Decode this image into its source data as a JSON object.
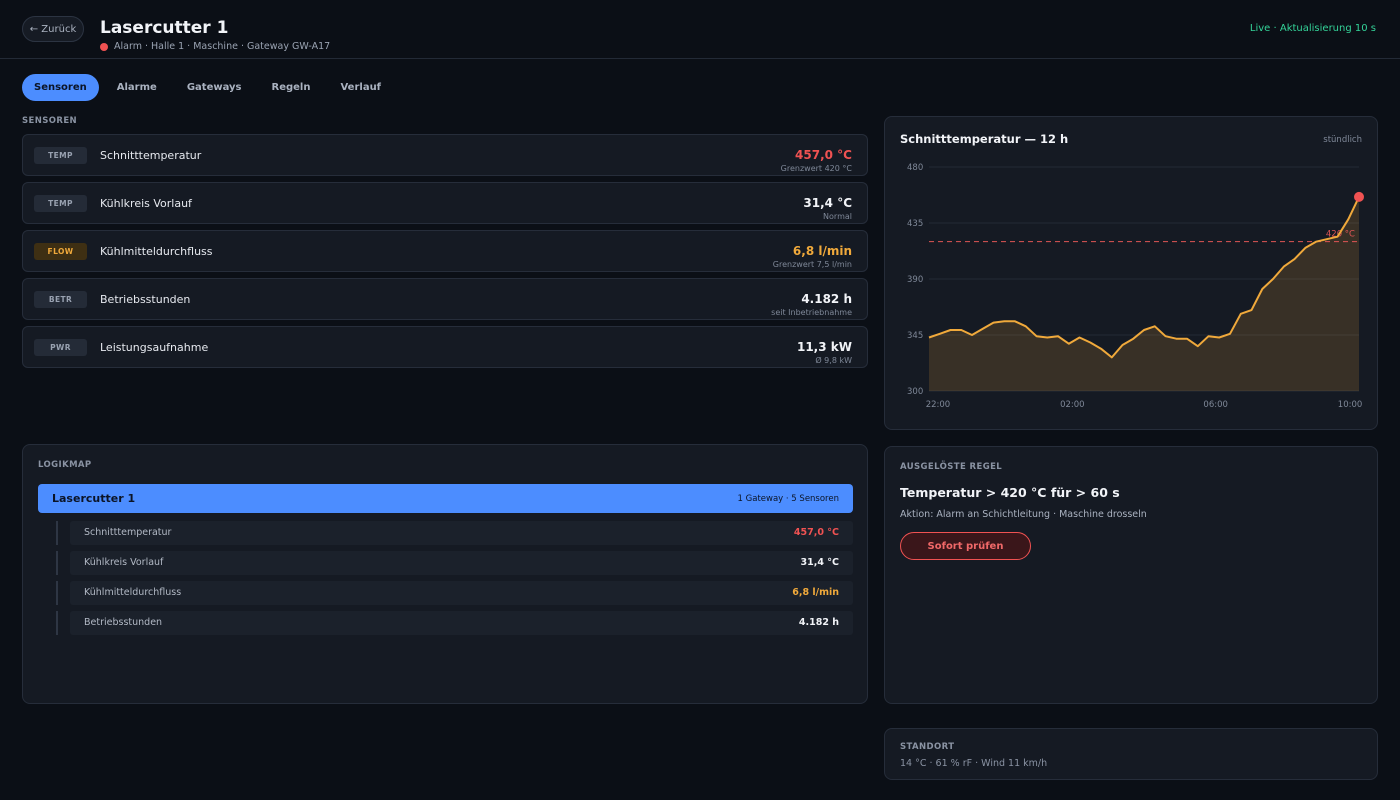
{
  "header": {
    "back_label": "← Zurück",
    "title": "Lasercutter 1",
    "subline": "Alarm · Halle 1 · Maschine · Gateway GW-A17",
    "live": "Live · Aktualisierung 10 s"
  },
  "tabs": [
    {
      "label": "Sensoren",
      "active": true
    },
    {
      "label": "Alarme"
    },
    {
      "label": "Gateways"
    },
    {
      "label": "Regeln"
    },
    {
      "label": "Verlauf"
    }
  ],
  "sensors": {
    "section_label": "SENSOREN",
    "items": [
      {
        "tag": "TEMP",
        "name": "Schnitttemperatur",
        "value": "457,0 °C",
        "note": "Grenzwert 420 °C",
        "state": "alarm"
      },
      {
        "tag": "TEMP",
        "name": "Kühlkreis Vorlauf",
        "value": "31,4 °C",
        "note": "Normal",
        "state": "ok"
      },
      {
        "tag": "FLOW",
        "name": "Kühlmitteldurchfluss",
        "value": "6,8 l/min",
        "note": "Grenzwert 7,5 l/min",
        "state": "warn"
      },
      {
        "tag": "BETR",
        "name": "Betriebsstunden",
        "value": "4.182 h",
        "note": "seit Inbetriebnahme",
        "state": "ok"
      },
      {
        "tag": "PWR",
        "name": "Leistungsaufnahme",
        "value": "11,3 kW",
        "note": "Ø 9,8 kW",
        "state": "ok"
      }
    ]
  },
  "chart": {
    "title": "Schnitttemperatur — 12 h",
    "subtitle": "stündlich",
    "threshold_label": "420 °C",
    "colors": {
      "line": "#f0a93b",
      "threshold": "#e05555",
      "point": "#f05252"
    }
  },
  "chart_data": {
    "type": "area",
    "title": "Schnitttemperatur — 12 h",
    "xlabel": "",
    "ylabel": "",
    "ylim": [
      300,
      480
    ],
    "yticks": [
      300,
      345,
      390,
      435,
      480
    ],
    "xticks": [
      {
        "label": "22:00",
        "x": 0.25
      },
      {
        "label": "02:00",
        "x": 4
      },
      {
        "label": "06:00",
        "x": 8
      },
      {
        "label": "10:00",
        "x": 11.75
      }
    ],
    "x_range": [
      0,
      12
    ],
    "threshold": 420,
    "grid": true,
    "series": [
      {
        "values": [
          343,
          346,
          349,
          349,
          345,
          350,
          355,
          356,
          356,
          352,
          344,
          343,
          344,
          338,
          343,
          339,
          334,
          327,
          337,
          342,
          349,
          352,
          344,
          342,
          342,
          336,
          344,
          343,
          346,
          362,
          365,
          382,
          390,
          400,
          406,
          415,
          420,
          422,
          424,
          438,
          456
        ]
      }
    ]
  },
  "logicmap": {
    "section_label": "LOGIKMAP",
    "head_title": "Lasercutter 1",
    "head_meta": "1 Gateway · 5 Sensoren",
    "items": [
      {
        "name": "Schnitttemperatur",
        "value": "457,0 °C",
        "state": "alarm"
      },
      {
        "name": "Kühlkreis Vorlauf",
        "value": "31,4 °C",
        "state": "ok"
      },
      {
        "name": "Kühlmitteldurchfluss",
        "value": "6,8 l/min",
        "state": "warn"
      },
      {
        "name": "Betriebsstunden",
        "value": "4.182 h",
        "state": "ok"
      }
    ]
  },
  "rule": {
    "section_label": "AUSGELÖSTE REGEL",
    "title": "Temperatur > 420 °C für > 60 s",
    "action": "Aktion: Alarm an Schichtleitung · Maschine drosseln",
    "button_label": "Sofort prüfen"
  },
  "location": {
    "section_label": "STANDORT",
    "text": "14 °C · 61 % rF · Wind 11 km/h"
  }
}
